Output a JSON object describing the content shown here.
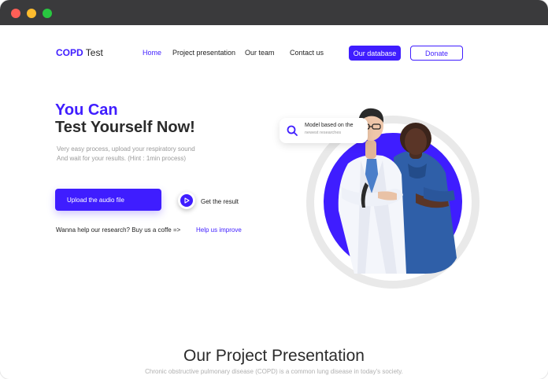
{
  "window": {
    "controls": [
      "close",
      "minimize",
      "maximize"
    ]
  },
  "navbar": {
    "logo_brand": "COPD",
    "logo_rest": "Test",
    "links": [
      "Home",
      "Project presentation",
      "Our team",
      "Contact us"
    ],
    "active_link": "Home",
    "database_label": "Our database",
    "donate_label": "Donate"
  },
  "hero": {
    "title_line1": "You Can",
    "title_line2": "Test Yourself Now!",
    "desc_line1": "Very easy process, upload your respiratory sound",
    "desc_line2": "And wait for your results. (Hint : 1min process)",
    "upload_label": "Upload the audio file",
    "result_label": "Get the result",
    "help_text": "Wanna help our research? Buy us a coffe =>",
    "help_link": "Help us improve"
  },
  "search_card": {
    "icon": "search-icon",
    "line1": "Model based on the",
    "line2": "newest researches"
  },
  "section": {
    "title": "Our Project Presentation",
    "subtitle": "Chronic obstructive pulmonary disease (COPD) is a common lung disease in today's society."
  },
  "colors": {
    "accent": "#3f1dff",
    "text_dark": "#2b2b2b",
    "text_muted": "#9a9a9a",
    "titlebar": "#3a3a3c"
  }
}
